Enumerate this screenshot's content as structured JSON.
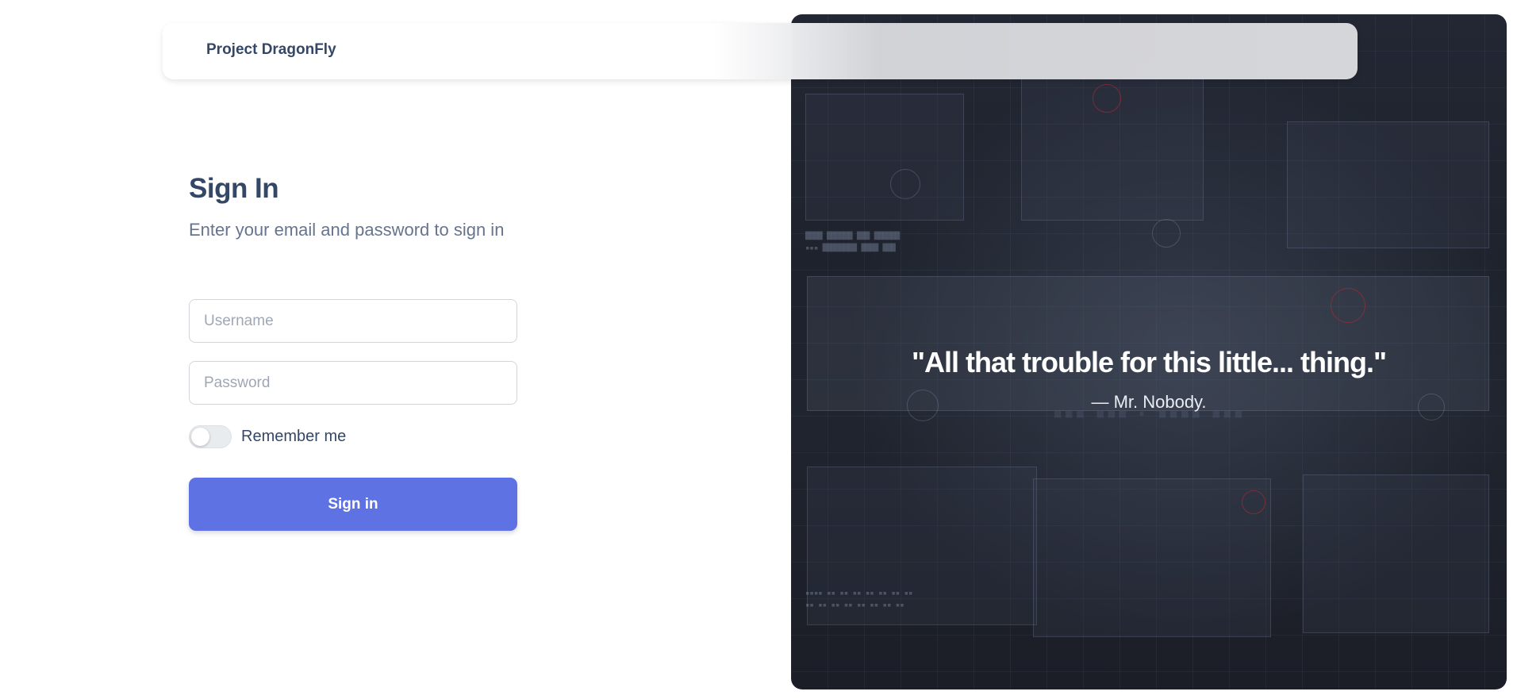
{
  "navbar": {
    "brand": "Project DragonFly"
  },
  "signin": {
    "title": "Sign In",
    "subtitle": "Enter your email and password to sign in",
    "username_placeholder": "Username",
    "password_placeholder": "Password",
    "remember_label": "Remember me",
    "remember_checked": false,
    "submit_label": "Sign in"
  },
  "hero": {
    "quote": "\"All that trouble for this little... thing.\"",
    "author": "— Mr. Nobody."
  },
  "colors": {
    "primary": "#5e72e4",
    "heading": "#344767",
    "muted": "#67748e",
    "hero_bg": "#1f232d"
  }
}
